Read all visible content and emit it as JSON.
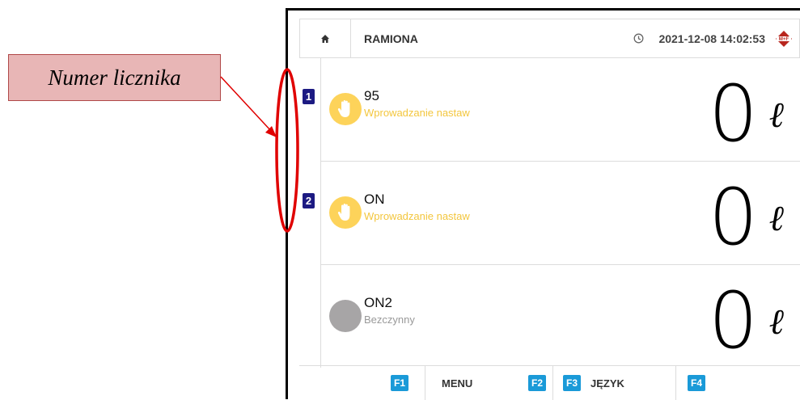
{
  "annotation": {
    "callout_text": "Numer licznika"
  },
  "header": {
    "home_icon": "home-icon",
    "title": "RAMIONA",
    "clock_icon": "clock-icon",
    "datetime": "2021-12-08 14:02:53",
    "logo_text": "M+F"
  },
  "counters": [
    {
      "number": "1",
      "name": "95",
      "status": "Wprowadzanie nastaw",
      "state": "active",
      "icon": "hand-icon",
      "volume": "0",
      "unit": "ℓ"
    },
    {
      "number": "2",
      "name": "ON",
      "status": "Wprowadzanie nastaw",
      "state": "active",
      "icon": "hand-icon",
      "volume": "0",
      "unit": "ℓ"
    },
    {
      "number": "",
      "name": "ON2",
      "status": "Bezczynny",
      "state": "idle",
      "icon": "idle-circle-icon",
      "volume": "0",
      "unit": "ℓ"
    }
  ],
  "footer": {
    "keys": [
      {
        "key": "F1",
        "label": "MENU"
      },
      {
        "key": "F2",
        "label": ""
      },
      {
        "key": "F3",
        "label": "JĘZYK"
      },
      {
        "key": "F4",
        "label": ""
      }
    ]
  },
  "colors": {
    "active_circle": "#fdd35a",
    "active_status_text": "#f3c63d",
    "idle_circle": "#a7a5a6",
    "badge": "#1c1a82",
    "function_key": "#1a9ad8",
    "annotation_fill": "#e8b6b6",
    "annotation_red": "#e00000"
  }
}
